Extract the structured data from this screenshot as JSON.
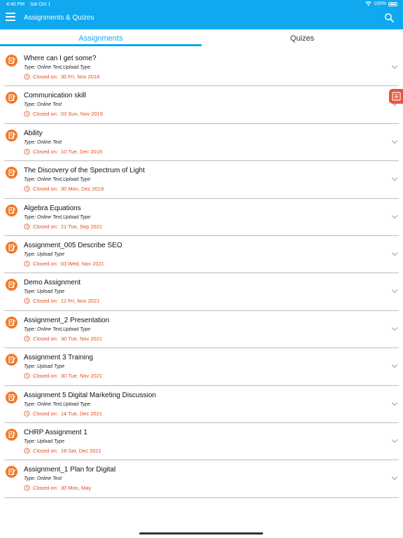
{
  "status_bar": {
    "time": "4:40 PM",
    "date": "Sat Oct 1",
    "battery": "100%"
  },
  "header": {
    "title": "Assignments & Quizes"
  },
  "tabs": [
    {
      "label": "Assignments",
      "active": true
    },
    {
      "label": "Quizes",
      "active": false
    }
  ],
  "closed_label": "Closed on:",
  "assignments": [
    {
      "title": "Where can I get some?",
      "type": "Type: Online Text,Upload Type",
      "closed": "30 Fri, Nov 2018"
    },
    {
      "title": "Communication skill",
      "type": "Type: Online Text",
      "closed": "03 Sun, Nov 2019"
    },
    {
      "title": "Ability",
      "type": "Type: Online Text",
      "closed": "10 Tue, Dec 2019"
    },
    {
      "title": "The Discovery of the Spectrum of Light",
      "type": "Type: Online Text,Upload Type",
      "closed": "30 Mon, Dec 2019"
    },
    {
      "title": "Algebra Equations",
      "type": "Type: Online Text,Upload Type",
      "closed": "21 Tue, Sep 2021"
    },
    {
      "title": "Assignment_005 Describe SEO",
      "type": "Type: Upload Type",
      "closed": "03 Wed, Nov 2021"
    },
    {
      "title": "Demo Assignment",
      "type": "Type: Upload Type",
      "closed": "12 Fri, Nov 2021"
    },
    {
      "title": "Assignment_2 Presentation",
      "type": "Type: Online Text,Upload Type",
      "closed": "30 Tue, Nov 2021"
    },
    {
      "title": "Assignment 3 Training",
      "type": "Type: Upload Type",
      "closed": "30 Tue, Nov 2021"
    },
    {
      "title": "Assignment 5 Digital Marketing Discussion",
      "type": "Type: Online Text,Upload Type",
      "closed": "14 Tue, Dec 2021"
    },
    {
      "title": "CHRP Assignment 1",
      "type": "Type: Upload Type",
      "closed": "18 Sat, Dec 2021"
    },
    {
      "title": "Assignment_1 Plan for Digital",
      "type": "Type: Online Text",
      "closed": "30 Mon, May"
    }
  ],
  "colors": {
    "header": "#10a8ee",
    "accent": "#10a8ee",
    "icon": "#f07a2b",
    "closed": "#e64a19",
    "side_tab": "#e5533d"
  },
  "icons": {
    "menu": "hamburger-icon",
    "search": "search-icon",
    "assignment": "assignment-edit-icon",
    "clock": "clock-icon",
    "expand": "chevron-down-icon",
    "side_tab": "notebook-icon",
    "wifi": "wifi-icon",
    "battery": "battery-icon"
  }
}
